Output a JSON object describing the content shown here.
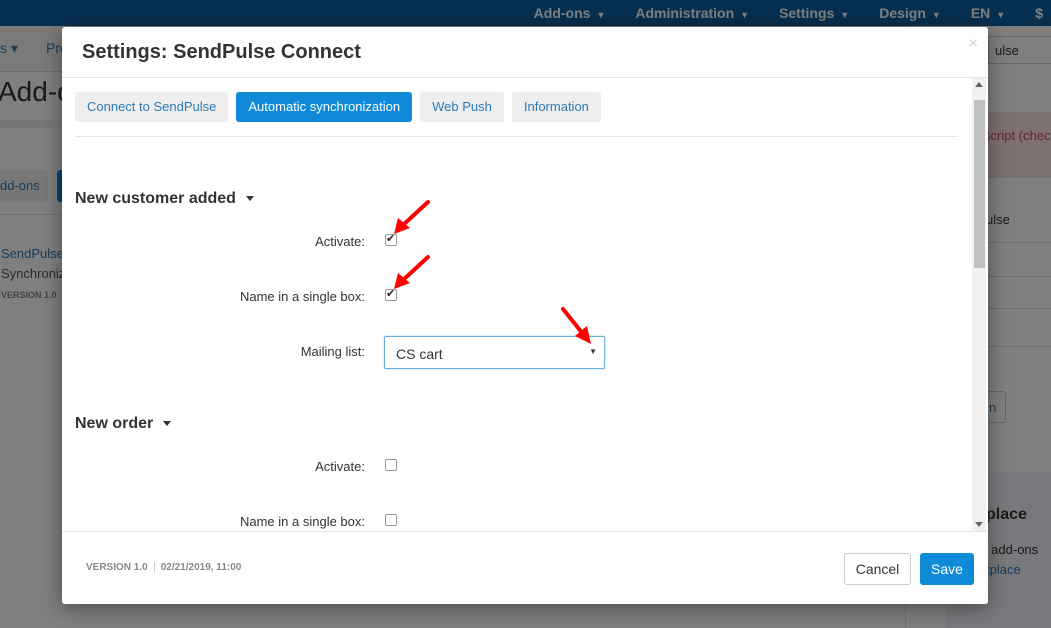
{
  "background": {
    "topnav": [
      {
        "label": "Add-ons"
      },
      {
        "label": "Administration"
      },
      {
        "label": "Settings"
      },
      {
        "label": "Design"
      },
      {
        "label": "EN"
      },
      {
        "label": "$"
      }
    ],
    "subnav_a": "s ▾",
    "subnav_b": "Pro",
    "page_title": "Add-on",
    "addons_button": "dd-ons",
    "addon_name": "SendPulse",
    "addon_desc": "Synchroniz",
    "addon_version": "VERSION 1.0",
    "right_search": "ulse",
    "right_alert": "script (chec",
    "right_name": "ulse",
    "right_button": "n",
    "market_title": "place",
    "market_text": "re add-ons",
    "market_link": "tplace"
  },
  "modal": {
    "title": "Settings: SendPulse Connect",
    "close": "×",
    "tabs": [
      {
        "label": "Connect to SendPulse",
        "active": false
      },
      {
        "label": "Automatic synchronization",
        "active": true
      },
      {
        "label": "Web Push",
        "active": false
      },
      {
        "label": "Information",
        "active": false
      }
    ],
    "sections": [
      {
        "title": "New customer added",
        "activate_label": "Activate:",
        "activate_checked": true,
        "single_box_label": "Name in a single box:",
        "single_box_checked": true,
        "mailing_list_label": "Mailing list:",
        "mailing_list_value": "CS cart"
      },
      {
        "title": "New order",
        "activate_label": "Activate:",
        "activate_checked": false,
        "single_box_label": "Name in a single box:",
        "single_box_checked": false
      }
    ],
    "footer": {
      "version": "VERSION 1.0",
      "date": "02/21/2019, 11:00",
      "cancel_label": "Cancel",
      "save_label": "Save"
    }
  },
  "colors": {
    "accent": "#0f8ad8",
    "topnav": "#0f5fa0",
    "annotation_arrow": "#ff0000"
  }
}
